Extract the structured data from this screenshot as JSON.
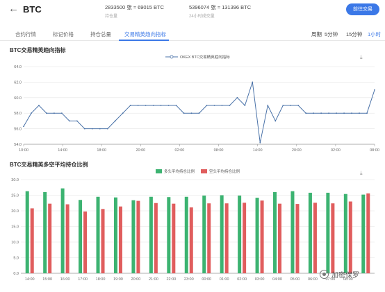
{
  "header": {
    "back_icon": "back-arrow-icon",
    "title": "BTC",
    "stats": [
      {
        "value": "2833500 张 ≈ 69015 BTC",
        "label": "持仓量"
      },
      {
        "value": "5396074 张 ≈ 131396 BTC",
        "label": "24小时成交量"
      }
    ],
    "trade_button": "前往交易"
  },
  "tabs": [
    {
      "label": "合约行情",
      "active": false
    },
    {
      "label": "标记价格",
      "active": false
    },
    {
      "label": "持仓总量",
      "active": false
    },
    {
      "label": "交易精英趋向指标",
      "active": true
    }
  ],
  "periods": {
    "label": "周期",
    "options": [
      {
        "label": "5分钟",
        "active": false
      },
      {
        "label": "15分钟",
        "active": false
      },
      {
        "label": "1小时",
        "active": true
      }
    ]
  },
  "accent_color": "#3b78e7",
  "charts": {
    "line_title": "BTC交易精英趋向指标",
    "line_legend": "OKEX BTC交易精英趋向指标",
    "bar_title": "BTC交易精英多空平均持仓比例",
    "bar_legend_long": "多头平均持仓比例",
    "bar_legend_short": "空头平均持仓比例",
    "download_icon": "download-icon"
  },
  "watermark": "加密保罗",
  "chart_data": [
    {
      "type": "line",
      "title": "BTC交易精英趋向指标",
      "series": [
        {
          "name": "OKEX BTC交易精英趋向指标",
          "color": "#4a72a8",
          "values": [
            56.3,
            58.0,
            59.0,
            58.0,
            58.0,
            58.0,
            57.0,
            57.0,
            56.0,
            56.0,
            56.0,
            56.0,
            57.0,
            58.0,
            59.0,
            59.0,
            59.0,
            59.0,
            59.0,
            59.0,
            59.0,
            58.0,
            58.0,
            58.0,
            59.0,
            59.0,
            59.0,
            59.0,
            60.0,
            59.0,
            62.0,
            54.2,
            59.0,
            57.0,
            59.0,
            59.0,
            59.0,
            58.0,
            58.0,
            58.0,
            58.0,
            58.0,
            58.0,
            58.0,
            58.0,
            58.0,
            61.0
          ]
        }
      ],
      "yticks": [
        "54.0",
        "56.0",
        "58.0",
        "60.0",
        "62.0",
        "64.0"
      ],
      "xticks": [
        "10:00",
        "14:00",
        "18:00",
        "20:00",
        "02:00",
        "08:00",
        "14:00",
        "20:00",
        "02:00",
        "08:00"
      ],
      "ylim": [
        54,
        64
      ],
      "grid": true,
      "legend": "top-center"
    },
    {
      "type": "bar",
      "title": "BTC交易精英多空平均持仓比例",
      "categories": [
        "14:00",
        "15:00",
        "16:00",
        "17:00",
        "18:00",
        "19:00",
        "20:00",
        "21:00",
        "22:00",
        "23:00",
        "00:00",
        "01:00",
        "02:00",
        "03:00",
        "04:00",
        "05:00",
        "06:00",
        "07:00",
        "08:00"
      ],
      "series": [
        {
          "name": "多头平均持仓比例",
          "color": "#3cb371",
          "values": [
            26.3,
            26.0,
            27.2,
            23.5,
            24.5,
            24.3,
            23.4,
            24.5,
            24.4,
            24.5,
            24.9,
            25.0,
            24.9,
            24.2,
            26.0,
            26.3,
            25.8,
            25.8,
            25.4,
            25.2
          ]
        },
        {
          "name": "空头平均持仓比例",
          "color": "#e05d5d",
          "values": [
            20.8,
            22.3,
            22.1,
            19.8,
            20.6,
            21.4,
            23.2,
            22.5,
            22.3,
            21.1,
            22.4,
            22.4,
            22.6,
            23.3,
            22.3,
            22.2,
            22.6,
            22.4,
            23.0,
            25.6
          ]
        }
      ],
      "yticks": [
        "0.0",
        "5.0",
        "10.0",
        "15.0",
        "20.0",
        "25.0",
        "30.0"
      ],
      "ylim": [
        0,
        30
      ],
      "grid": true,
      "legend": "top-center"
    }
  ]
}
